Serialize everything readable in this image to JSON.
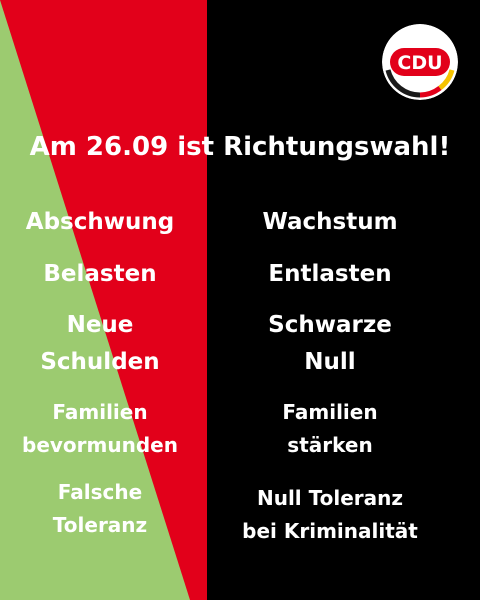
{
  "colors": {
    "green": "#9ccb70",
    "red": "#e2001a",
    "black": "#000000",
    "white": "#ffffff"
  },
  "logo": {
    "text": "CDU",
    "icon": "cdu-logo"
  },
  "headline": "Am 26.09 ist Richtungswahl!",
  "left": [
    {
      "lines": [
        "Abschwung"
      ]
    },
    {
      "lines": [
        "Belasten"
      ]
    },
    {
      "lines": [
        "Neue",
        "Schulden"
      ]
    },
    {
      "lines": [
        "Familien",
        "bevormunden"
      ]
    },
    {
      "lines": [
        "Falsche",
        "Toleranz"
      ]
    }
  ],
  "right": [
    {
      "lines": [
        "Wachstum"
      ]
    },
    {
      "lines": [
        "Entlasten"
      ]
    },
    {
      "lines": [
        "Schwarze",
        "Null"
      ]
    },
    {
      "lines": [
        "Familien",
        "stärken"
      ]
    },
    {
      "lines": [
        "Null Toleranz",
        "bei Kriminalität"
      ]
    }
  ]
}
